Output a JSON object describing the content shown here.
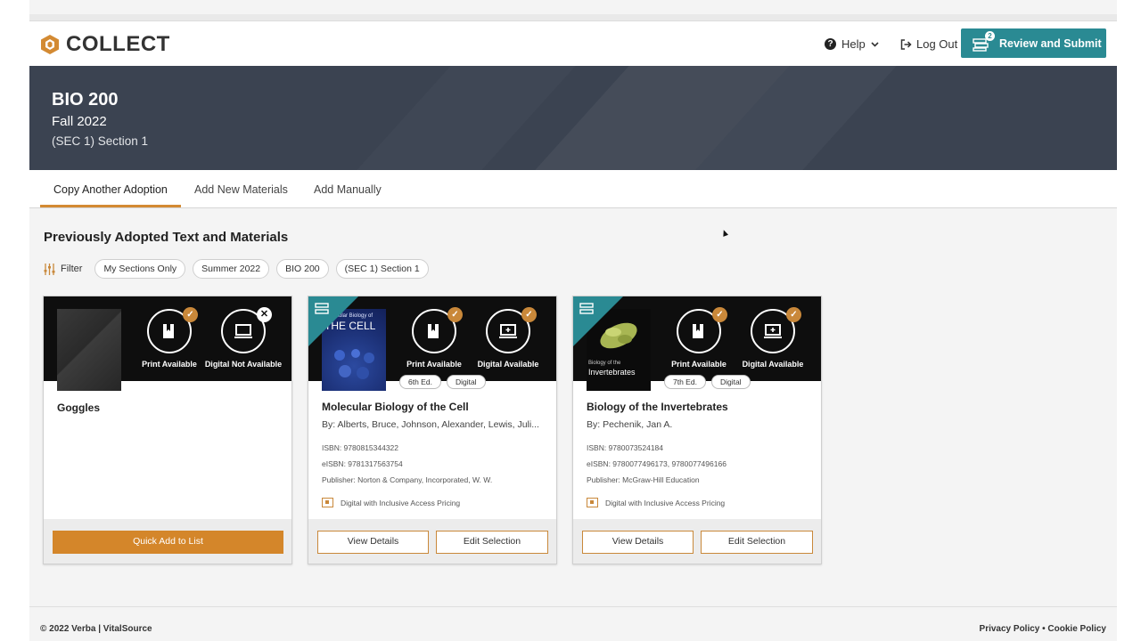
{
  "app": {
    "logo_text": "COLLECT",
    "brand_color": "#d38a33",
    "accent_color": "#2a8a93"
  },
  "header": {
    "help_label": "Help",
    "logout_label": "Log Out",
    "review_label": "Review and Submit",
    "cart_count": "2"
  },
  "course": {
    "code": "BIO 200",
    "term": "Fall 2022",
    "section": "(SEC 1) Section 1"
  },
  "tabs": [
    {
      "label": "Copy Another Adoption",
      "active": true
    },
    {
      "label": "Add New Materials"
    },
    {
      "label": "Add Manually"
    }
  ],
  "main": {
    "heading": "Previously Adopted Text and Materials",
    "filter_label": "Filter",
    "filter_chips": [
      "My Sections Only",
      "Summer 2022",
      "BIO 200",
      "(SEC 1) Section 1"
    ]
  },
  "cards": [
    {
      "title": "Goggles",
      "print_label": "Print Available",
      "digital_label": "Digital Not Available",
      "button": "Quick Add to List"
    },
    {
      "title": "Molecular Biology of the Cell",
      "cover_text_top": "Molecular Biology of",
      "cover_text_main": "THE CELL",
      "authors": "By: Alberts, Bruce, Johnson, Alexander, Lewis, Juli...",
      "isbn": "ISBN: 9780815344322",
      "eisbn": "eISBN: 9781317563754",
      "publisher": "Publisher: Norton & Company, Incorporated, W. W.",
      "edition": "6th Ed.",
      "format": "Digital",
      "print_label": "Print Available",
      "digital_label": "Digital Available",
      "inclusive": "Digital with Inclusive Access Pricing",
      "view_button": "View Details",
      "edit_button": "Edit Selection"
    },
    {
      "title": "Biology of the Invertebrates",
      "cover_text_top": "Biology of the",
      "cover_text_main": "Invertebrates",
      "authors": "By: Pechenik, Jan A.",
      "isbn": "ISBN: 9780073524184",
      "eisbn": "eISBN: 9780077496173, 9780077496166",
      "publisher": "Publisher: McGraw-Hill Education",
      "edition": "7th Ed.",
      "format": "Digital",
      "print_label": "Print Available",
      "digital_label": "Digital Available",
      "inclusive": "Digital with Inclusive Access Pricing",
      "view_button": "View Details",
      "edit_button": "Edit Selection"
    }
  ],
  "footer": {
    "copyright": "© 2022 Verba | VitalSource",
    "policies": "Privacy Policy • Cookie Policy"
  }
}
